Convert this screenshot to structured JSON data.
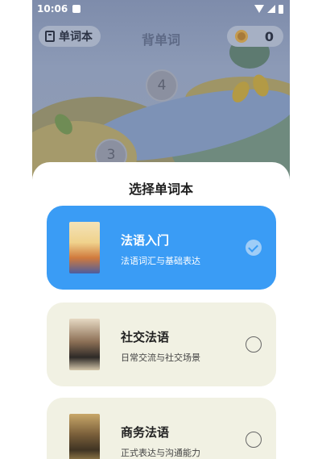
{
  "status_bar": {
    "time": "10:06"
  },
  "header": {
    "wordbook_label": "单词本",
    "title": "背单词",
    "coins": "0"
  },
  "map": {
    "nodes": [
      "4",
      "3"
    ]
  },
  "sheet": {
    "title": "选择单词本",
    "books": [
      {
        "name": "法语入门",
        "desc": "法语词汇与基础表达",
        "selected": true
      },
      {
        "name": "社交法语",
        "desc": "日常交流与社交场景",
        "selected": false
      },
      {
        "name": "商务法语",
        "desc": "正式表达与沟通能力",
        "selected": false
      }
    ]
  },
  "colors": {
    "accent": "#3a9cf5",
    "card_bg": "#f1f1e3"
  }
}
